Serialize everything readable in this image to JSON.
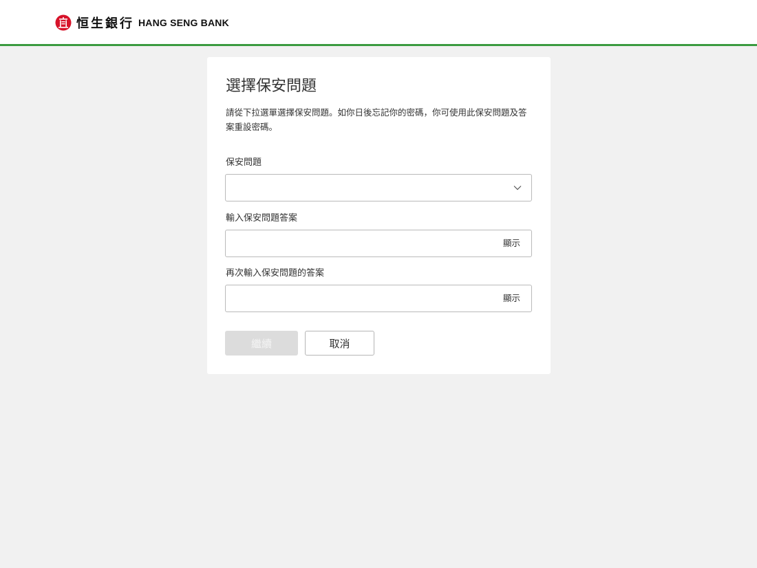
{
  "brand": {
    "name_cn": "恒生銀行",
    "name_en": "HANG SENG BANK",
    "accent_color": "#3b9a3f",
    "logo_color": "#d7132a"
  },
  "page": {
    "title": "選擇保安問題",
    "description": "請從下拉選單選擇保安問題。如你日後忘記你的密碼，你可使用此保安問題及答案重設密碼。"
  },
  "form": {
    "question": {
      "label": "保安問題",
      "value": "",
      "icon": "chevron-down-icon"
    },
    "answer": {
      "label": "輸入保安問題答案",
      "value": "",
      "toggle_label": "顯示"
    },
    "confirm_answer": {
      "label": "再次輸入保安問題的答案",
      "value": "",
      "toggle_label": "顯示"
    }
  },
  "actions": {
    "continue_label": "繼續",
    "continue_disabled": true,
    "cancel_label": "取消"
  }
}
